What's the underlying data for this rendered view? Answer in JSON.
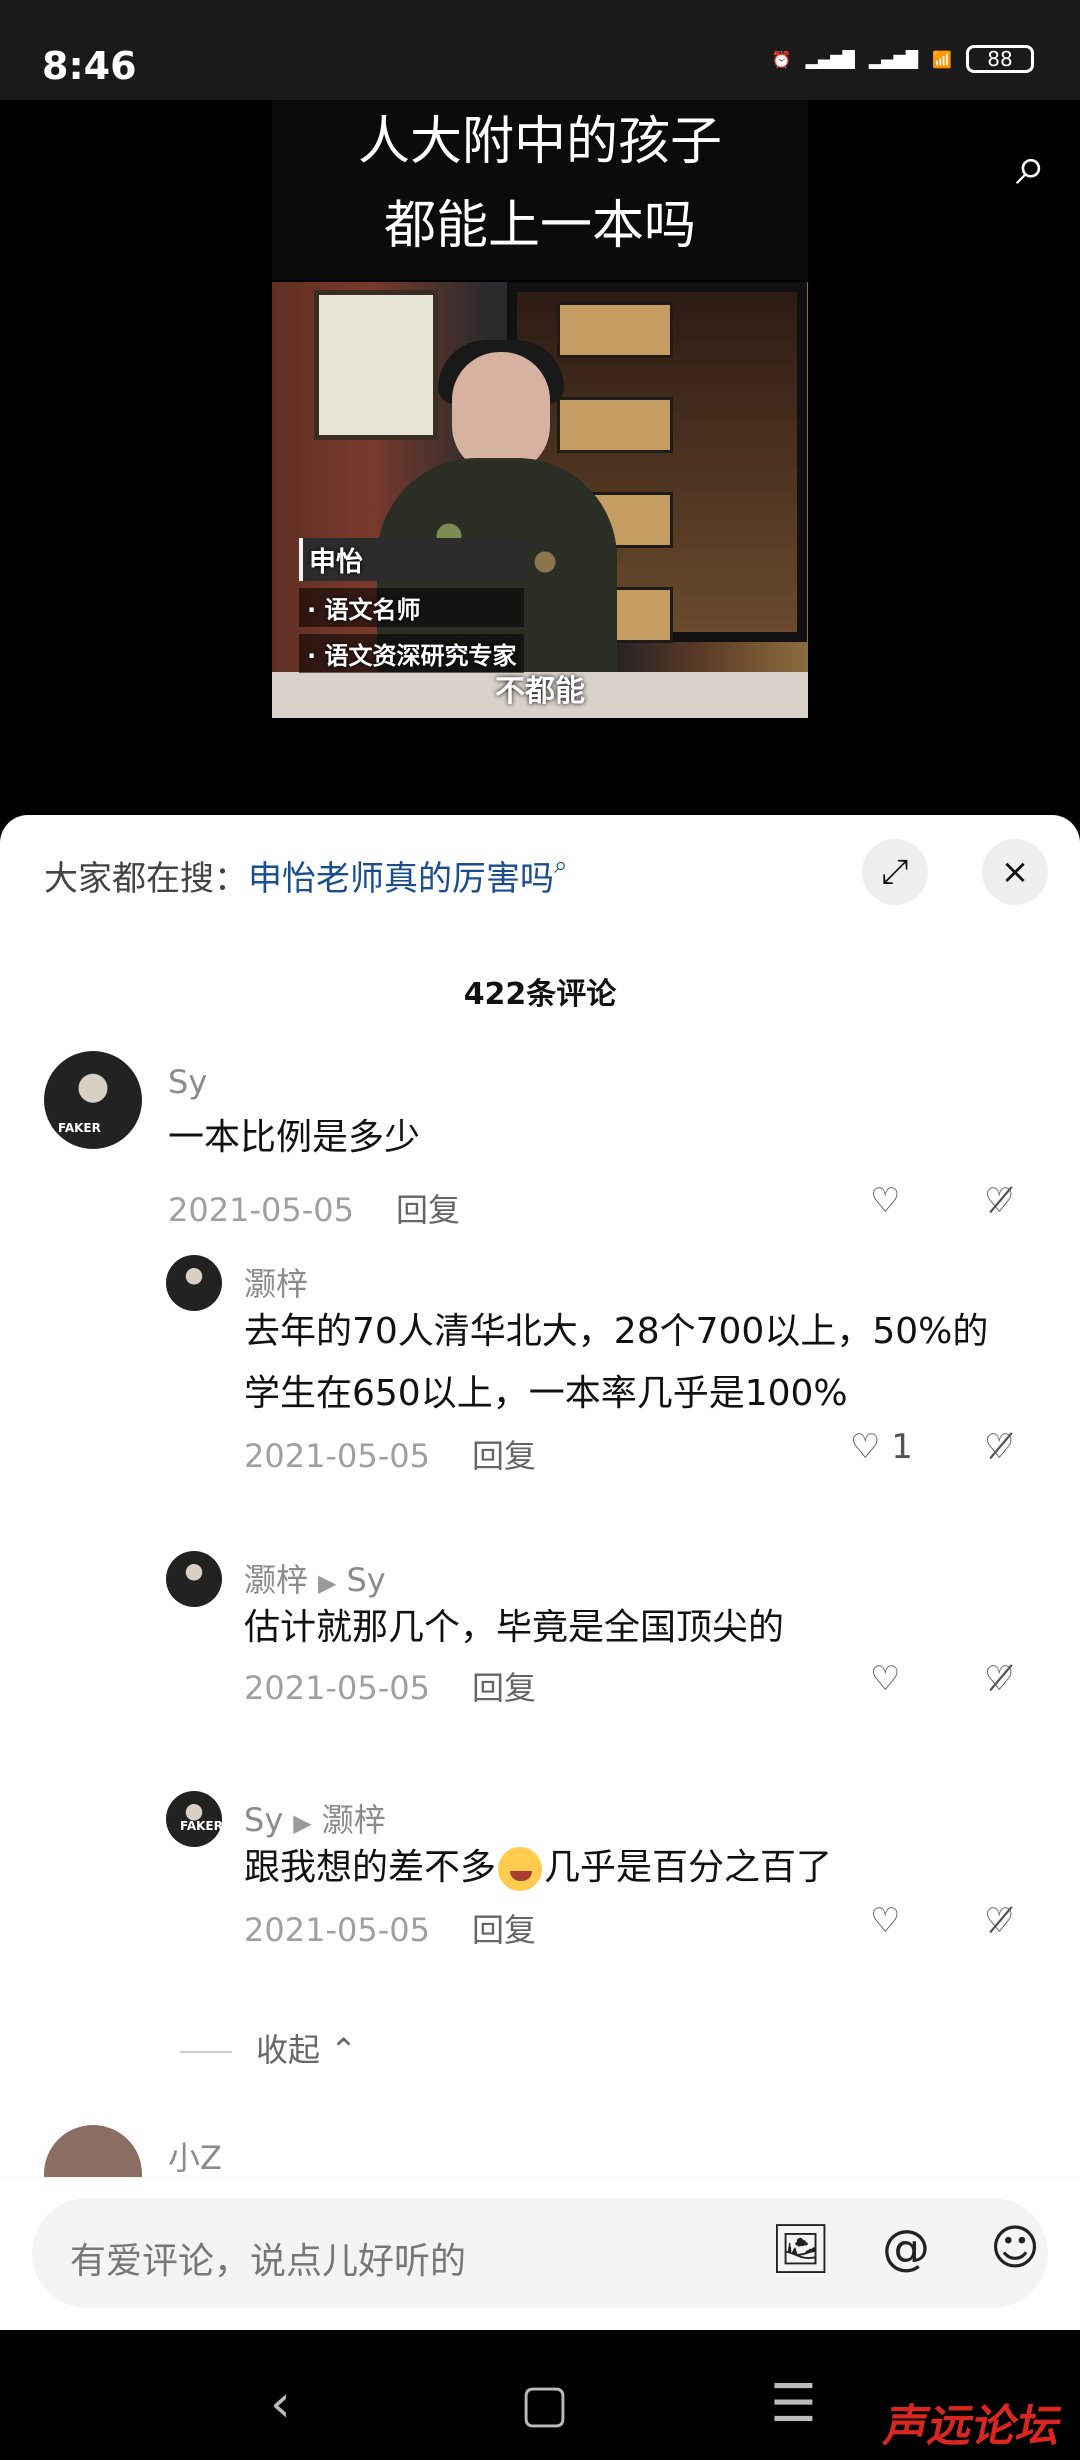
{
  "status": {
    "time": "8:46",
    "battery": "88"
  },
  "video": {
    "title_line1": "人大附中的孩子",
    "title_line2": "都能上一本吗",
    "name": "申怡",
    "bullet1": "· 语文名师",
    "bullet2": "· 语文资深研究专家",
    "subtitle": "不都能"
  },
  "search": {
    "prefix": "大家都在搜：",
    "query": "申怡老师真的厉害吗"
  },
  "comments": {
    "count": "422条评论",
    "reply_label": "回复",
    "collapse_label": "收起 ⌃",
    "items": [
      {
        "author": "Sy",
        "text": "一本比例是多少",
        "date": "2021-05-05",
        "likes": ""
      },
      {
        "author": "灏梓",
        "text": "去年的70人清华北大，28个700以上，50%的学生在650以上，一本率几乎是100%",
        "date": "2021-05-05",
        "likes": "1"
      },
      {
        "author": "灏梓",
        "reply_to": "Sy",
        "text": "估计就那几个，毕竟是全国顶尖的",
        "date": "2021-05-05",
        "likes": ""
      },
      {
        "author": "Sy",
        "reply_to": "灏梓",
        "text_before": "跟我想的差不多",
        "text_after": "几乎是百分之百了",
        "date": "2021-05-05",
        "likes": ""
      },
      {
        "author": "小Z"
      }
    ]
  },
  "input": {
    "placeholder": "有爱评论，说点儿好听的"
  },
  "icons": {
    "search": "search-icon",
    "expand": "expand-icon",
    "close": "close-icon",
    "like": "heart-icon",
    "dislike": "broken-heart-icon",
    "image": "image-icon",
    "mention": "at-icon",
    "emoji": "emoji-icon"
  },
  "watermark": "声远论坛"
}
